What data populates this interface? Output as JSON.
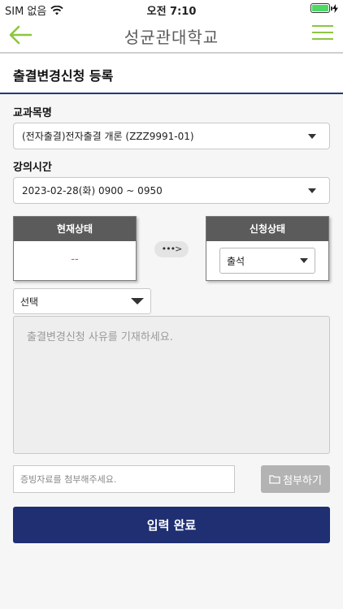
{
  "status_bar": {
    "carrier": "SIM 없음",
    "time": "오전 7:10",
    "wifi_icon": "wifi-icon",
    "battery_level": 1.0,
    "battery_color": "#4cd964"
  },
  "nav": {
    "title": "성균관대학교",
    "back_icon": "arrow-left-icon",
    "menu_icon": "hamburger-icon",
    "accent_color": "#8dc63f"
  },
  "page": {
    "title": "출결변경신청 등록"
  },
  "form": {
    "course_label": "교과목명",
    "course_value": "(전자출결)전자출결 개론 (ZZZ9991-01)",
    "lecture_time_label": "강의시간",
    "lecture_time_value": "2023-02-28(화) 0900 ~ 0950",
    "current_status_label": "현재상태",
    "current_status_value": "--",
    "arrow_text": "•••>",
    "request_status_label": "신청상태",
    "request_status_value": "출석",
    "reason_select_value": "선택",
    "reason_placeholder": "출결변경신청 사유를 기재하세요.",
    "attachment_placeholder": "증빙자료를 첨부해주세요.",
    "attach_button_label": "첨부하기",
    "attach_icon": "folder-icon",
    "submit_label": "입력 완료",
    "submit_color": "#1f2f72"
  }
}
